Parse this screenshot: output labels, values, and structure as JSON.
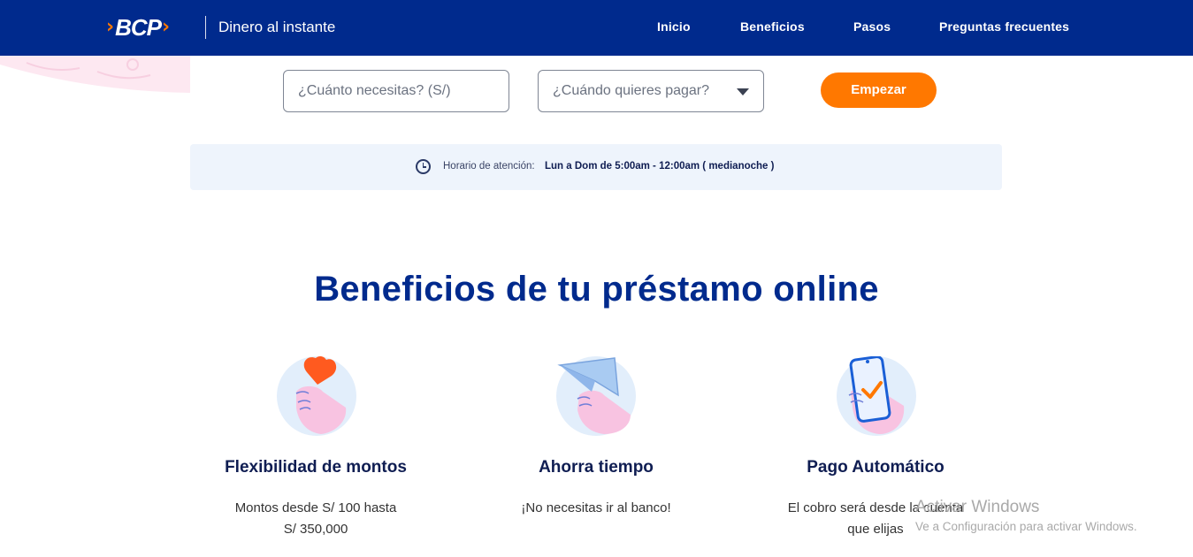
{
  "header": {
    "brand": "BCP",
    "tagline": "Dinero al instante",
    "nav": [
      "Inicio",
      "Beneficios",
      "Pasos",
      "Preguntas frecuentes"
    ]
  },
  "form": {
    "amount_placeholder": "¿Cuánto necesitas? (S/)",
    "when_placeholder": "¿Cuándo quieres pagar?",
    "start_button": "Empezar"
  },
  "schedule": {
    "label": "Horario de atención:",
    "value": "Lun a Dom de 5:00am - 12:00am ( medianoche )"
  },
  "benefits": {
    "title": "Beneficios de tu préstamo online",
    "items": [
      {
        "title": "Flexibilidad de montos",
        "line1": "Montos desde S/ 100 hasta",
        "line2": "S/ 350,000",
        "icon": "heart-hand-icon"
      },
      {
        "title": "Ahorra tiempo",
        "line1": "¡No necesitas ir al banco!",
        "line2": "",
        "icon": "paper-plane-hand-icon"
      },
      {
        "title": "Pago Automático",
        "line1": "El cobro será desde la cuenta",
        "line2": "que elijas",
        "icon": "phone-check-hand-icon"
      }
    ]
  },
  "watermark": {
    "line1": "Activar Windows",
    "line2": "Ve a Configuración para activar Windows."
  },
  "colors": {
    "primary": "#002a8d",
    "accent": "#ff7800",
    "schedule_bg": "#eef4fc"
  }
}
